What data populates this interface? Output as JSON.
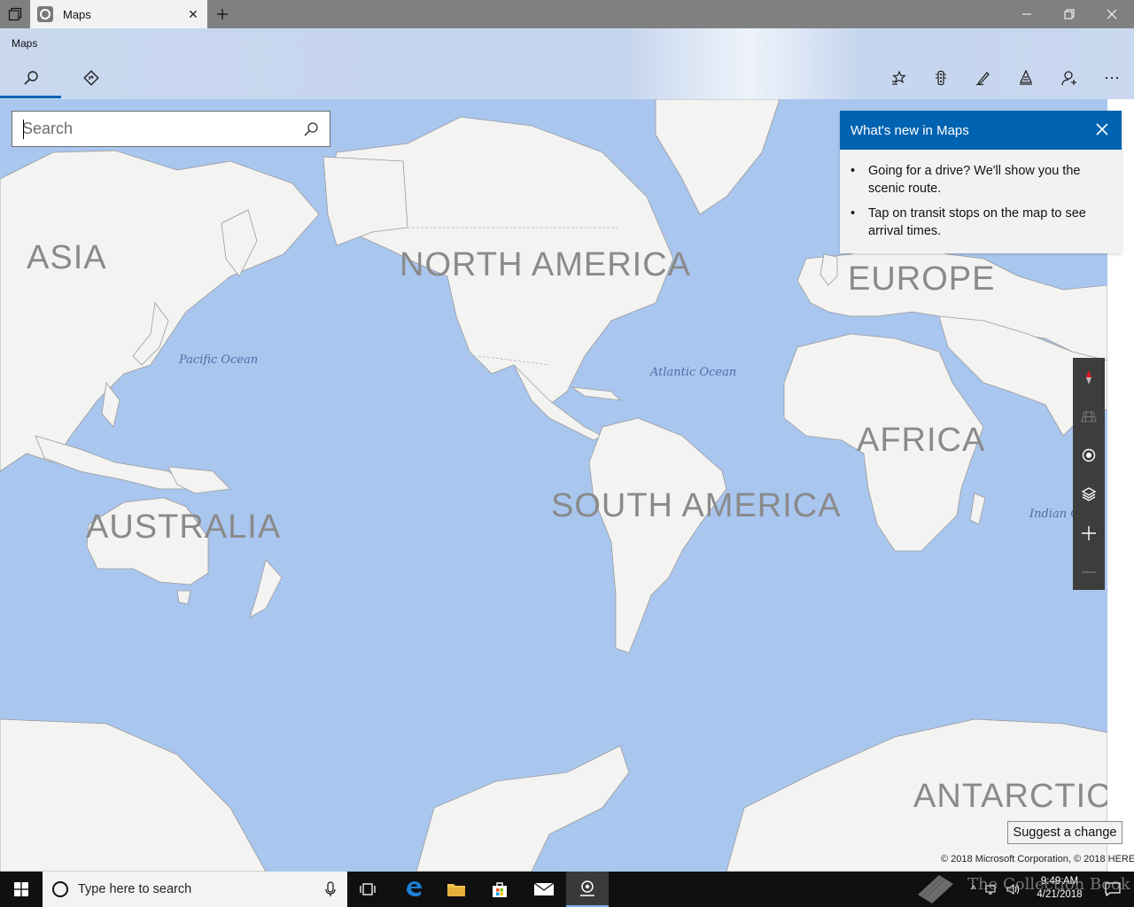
{
  "tab": {
    "title": "Maps"
  },
  "app": {
    "title": "Maps",
    "search": {
      "placeholder": "Search",
      "value": ""
    }
  },
  "whats_new": {
    "title": "What's new in Maps",
    "items": [
      "Going for a drive? We'll show you the scenic route.",
      "Tap on transit stops on the map to see arrival times."
    ]
  },
  "map": {
    "continents": [
      "ASIA",
      "NORTH AMERICA",
      "EUROPE",
      "AFRICA",
      "SOUTH AMERICA",
      "AUSTRALIA",
      "ANTARCTICA"
    ],
    "oceans": [
      "Pacific Ocean",
      "Atlantic Ocean",
      "Indian O"
    ],
    "suggest_label": "Suggest a change",
    "copyright": "© 2018 Microsoft Corporation, © 2018 HERE"
  },
  "taskbar": {
    "search_placeholder": "Type here to search",
    "time": "9:49 AM",
    "date": "4/21/2018"
  },
  "watermark": "The Collection Book",
  "colors": {
    "accent": "#0063b1",
    "water": "#a9c6ef",
    "land": "#f3f3f1"
  }
}
